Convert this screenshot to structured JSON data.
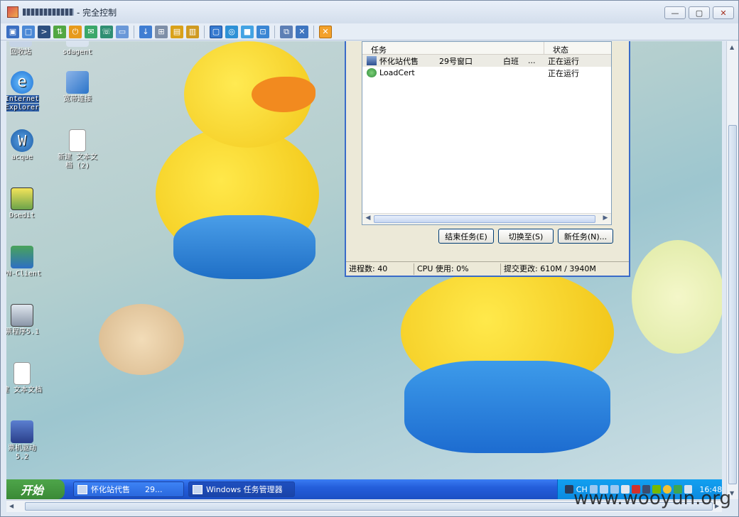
{
  "window": {
    "title_suffix": "- 完全控制",
    "buttons": [
      "—",
      "▢",
      "✕"
    ]
  },
  "toolbar": {
    "icons": [
      "monitor-icon",
      "screen-icon",
      "terminal-icon",
      "transfer-icon",
      "power-icon",
      "chat-icon",
      "phone-icon",
      "message-icon",
      "download-icon",
      "hierarchy-icon",
      "lock-icon",
      "unlock-icon",
      "fullscreen-icon",
      "fit-icon",
      "scale-icon",
      "zoom-icon",
      "network-icon",
      "tools-icon",
      "close-session-icon"
    ]
  },
  "desktop": {
    "icons": [
      {
        "label": "回收站",
        "name": "recycle-bin-shortcut"
      },
      {
        "label": "sdagent",
        "name": "sdagent-shortcut"
      },
      {
        "label": "Internet Explorer",
        "name": "internet-explorer-shortcut"
      },
      {
        "label": "宽带连接",
        "name": "broadband-connection-shortcut"
      },
      {
        "label": "acque",
        "name": "acque-shortcut"
      },
      {
        "label": "新建 文本文档 (2)",
        "name": "new-text-doc-2-shortcut"
      },
      {
        "label": "Dsedit",
        "name": "dsedit-shortcut"
      },
      {
        "label": "PN-Client",
        "name": "pn-client-shortcut"
      },
      {
        "label": "票程序5.1",
        "name": "ticket-program-shortcut"
      },
      {
        "label": "建 文本文档",
        "name": "new-text-doc-shortcut"
      },
      {
        "label": "票机驱动 5.2",
        "name": "ticket-driver-shortcut"
      }
    ]
  },
  "taskmgr": {
    "columns": [
      "任务",
      "状态"
    ],
    "rows": [
      {
        "task": "怀化站代售",
        "col2": "29号窗口",
        "col3": "白班",
        "col4": "...",
        "status": "正在运行"
      },
      {
        "task": "LoadCert",
        "col2": "",
        "col3": "",
        "col4": "",
        "status": "正在运行"
      }
    ],
    "buttons": {
      "end": "结束任务(E)",
      "switch": "切换至(S)",
      "new": "新任务(N)..."
    },
    "status": {
      "processes": "进程数: 40",
      "cpu": "CPU 使用: 0%",
      "commit": "提交更改: 610M / 3940M"
    }
  },
  "taskbar": {
    "start": "开始",
    "tasks": [
      {
        "label": "怀化站代售      29..."
      },
      {
        "label": "Windows 任务管理器"
      }
    ],
    "tray_lang": "CH",
    "clock": "16:48"
  },
  "watermark": "www.wooyun.org",
  "colors": {
    "accent": "#245edb",
    "start": "#3a8a36",
    "title_bar": "#d3deec"
  }
}
